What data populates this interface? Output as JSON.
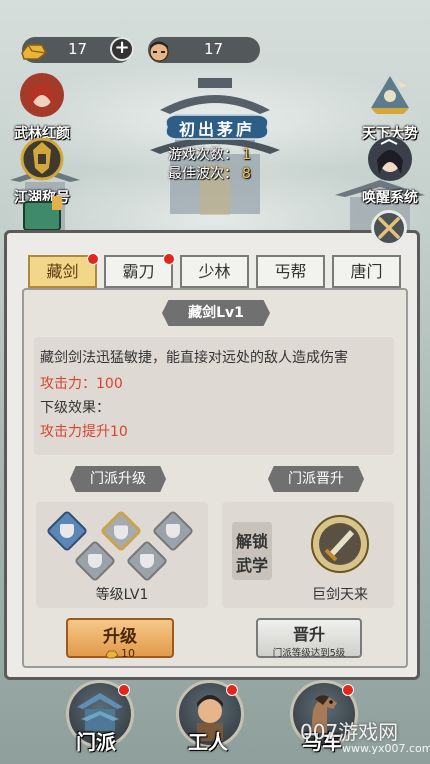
{
  "top_resources": {
    "gold": {
      "icon": "gold-ingot-icon",
      "value": "17"
    },
    "tickets": {
      "icon": "hero-head-icon",
      "value": "17"
    }
  },
  "side_menu_left": [
    {
      "label": "武林红颜",
      "icon": "heroine-portrait-icon"
    },
    {
      "label": "江湖称号",
      "icon": "title-emblem-icon"
    }
  ],
  "side_menu_right": [
    {
      "label": "天下大势",
      "icon": "world-situation-icon"
    },
    {
      "label": "唤醒系统",
      "icon": "awaken-portrait-icon"
    }
  ],
  "stage": {
    "title": "初出茅庐",
    "play_count_label": "游戏次数：",
    "play_count_value": "1",
    "best_wave_label": "最佳波次：",
    "best_wave_value": "8"
  },
  "tabs": [
    {
      "label": "藏剑",
      "active": true,
      "badge": true
    },
    {
      "label": "霸刀",
      "active": false,
      "badge": true
    },
    {
      "label": "少林",
      "active": false,
      "badge": false
    },
    {
      "label": "丐帮",
      "active": false,
      "badge": false
    },
    {
      "label": "唐门",
      "active": false,
      "badge": false
    }
  ],
  "skill": {
    "name": "藏剑Lv1",
    "description": "藏剑剑法迅猛敏捷，能直接对远处的敌人造成伤害",
    "attack_label": "攻击力：100",
    "next_effect_label": "下级效果：",
    "next_effect_value": "攻击力提升10"
  },
  "upgrade_section": {
    "title": "门派升级",
    "level_label": "等级LV1",
    "button_label": "升级",
    "cost": "10"
  },
  "promote_section": {
    "title": "门派晋升",
    "unlock_label_1": "解锁",
    "unlock_label_2": "武学",
    "martial_art_name": "巨剑天来",
    "button_label": "晋升",
    "button_sub": "门派等级达到5级"
  },
  "bottom_nav": [
    {
      "label": "门派",
      "icon": "sect-pavilion-icon"
    },
    {
      "label": "工人",
      "icon": "worker-icon"
    },
    {
      "label": "马车",
      "icon": "horse-icon"
    }
  ],
  "watermark": {
    "text": "007游戏网",
    "sub": "www.yx007.com"
  },
  "colors": {
    "accent_red": "#d9432e",
    "gold": "#f2c44a",
    "tab_active": "#f2d68a"
  }
}
